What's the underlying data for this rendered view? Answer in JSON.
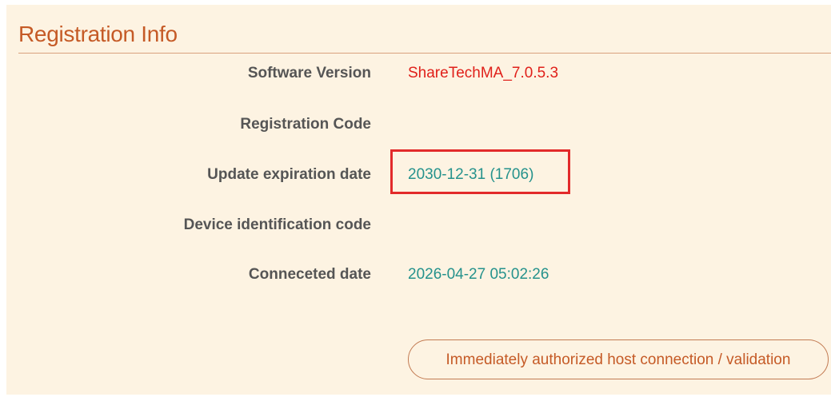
{
  "panel": {
    "title": "Registration Info"
  },
  "rows": [
    {
      "label": "Software Version",
      "value": "ShareTechMA_7.0.5.3"
    },
    {
      "label": "Registration Code",
      "value": ""
    },
    {
      "label": "Update expiration date",
      "value": "2030-12-31 (1706)"
    },
    {
      "label": "Device identification code",
      "value": ""
    },
    {
      "label": "Conneceted date",
      "value": "2026-04-27 05:02:26"
    }
  ],
  "actions": {
    "authorize_label": "Immediately authorized host connection / validation"
  },
  "colors": {
    "panel_background": "#fdf3e2",
    "title": "#c55a26",
    "label": "#555555",
    "version_value": "#e0201a",
    "date_value": "#25928c",
    "highlight": "#e22a2a"
  }
}
